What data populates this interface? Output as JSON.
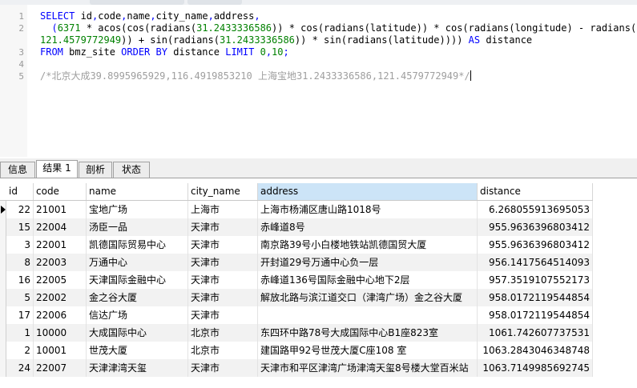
{
  "editor": {
    "line_numbers": [
      "1",
      "2",
      "",
      "3",
      "4",
      "5"
    ],
    "lines": [
      [
        {
          "c": "kw",
          "t": "SELECT "
        },
        {
          "c": "plain",
          "t": "id"
        },
        {
          "c": "kw",
          "t": ","
        },
        {
          "c": "plain",
          "t": "code"
        },
        {
          "c": "kw",
          "t": ","
        },
        {
          "c": "plain",
          "t": "name"
        },
        {
          "c": "kw",
          "t": ","
        },
        {
          "c": "plain",
          "t": "city_name"
        },
        {
          "c": "kw",
          "t": ","
        },
        {
          "c": "plain",
          "t": "address"
        },
        {
          "c": "kw",
          "t": ","
        }
      ],
      [
        {
          "c": "kw",
          "t": "  ("
        },
        {
          "c": "num",
          "t": "6371"
        },
        {
          "c": "plain",
          "t": " * acos(cos(radians("
        },
        {
          "c": "num",
          "t": "31.2433336586"
        },
        {
          "c": "plain",
          "t": ")) * cos(radians(latitude)) * cos(radians(longitude) - radians("
        }
      ],
      [
        {
          "c": "num",
          "t": "121.4579772949"
        },
        {
          "c": "plain",
          "t": ")) + sin(radians("
        },
        {
          "c": "num",
          "t": "31.2433336586"
        },
        {
          "c": "plain",
          "t": ")) * sin(radians(latitude)))) "
        },
        {
          "c": "kw",
          "t": "AS "
        },
        {
          "c": "plain",
          "t": "distance"
        }
      ],
      [
        {
          "c": "kw",
          "t": "FROM "
        },
        {
          "c": "plain",
          "t": "bmz_site "
        },
        {
          "c": "kw",
          "t": "ORDER BY "
        },
        {
          "c": "plain",
          "t": "distance "
        },
        {
          "c": "kw",
          "t": "LIMIT "
        },
        {
          "c": "num",
          "t": "0"
        },
        {
          "c": "kw",
          "t": ","
        },
        {
          "c": "num",
          "t": "10"
        },
        {
          "c": "kw",
          "t": ";"
        }
      ],
      [],
      [
        {
          "c": "cmt",
          "t": "/*北京大成39.8995965929,116.4919853210 上海宝地31.2433336586,121.4579772949*/"
        }
      ]
    ]
  },
  "tabs": [
    {
      "label": "信息",
      "active": false
    },
    {
      "label": "结果 1",
      "active": true
    },
    {
      "label": "剖析",
      "active": false
    },
    {
      "label": "状态",
      "active": false
    }
  ],
  "grid": {
    "columns": [
      "id",
      "code",
      "name",
      "city_name",
      "address",
      "distance"
    ],
    "selected_column": "address",
    "rows": [
      {
        "id": "22",
        "code": "21001",
        "name": "宝地广场",
        "city_name": "上海市",
        "address": "上海市杨浦区唐山路1018号",
        "distance": "6.268055913695053"
      },
      {
        "id": "15",
        "code": "22004",
        "name": "汤臣一品",
        "city_name": "天津市",
        "address": "赤峰道8号",
        "distance": "955.9636396803412"
      },
      {
        "id": "3",
        "code": "22001",
        "name": "凯德国际贸易中心",
        "city_name": "天津市",
        "address": "南京路39号小白楼地铁站凯德国贸大厦",
        "distance": "955.9636396803412"
      },
      {
        "id": "8",
        "code": "22003",
        "name": "万通中心",
        "city_name": "天津市",
        "address": "开封道29号万通中心负一层",
        "distance": "956.1417564514093"
      },
      {
        "id": "16",
        "code": "22005",
        "name": "天津国际金融中心",
        "city_name": "天津市",
        "address": "赤峰道136号国际金融中心地下2层",
        "distance": "957.3519107552173"
      },
      {
        "id": "5",
        "code": "22002",
        "name": "金之谷大厦",
        "city_name": "天津市",
        "address": "解放北路与滨江道交口（津湾广场）金之谷大厦",
        "distance": "958.0172119544854"
      },
      {
        "id": "17",
        "code": "22006",
        "name": "信达广场",
        "city_name": "天津市",
        "address": "",
        "distance": "958.0172119544854"
      },
      {
        "id": "1",
        "code": "10000",
        "name": "大成国际中心",
        "city_name": "北京市",
        "address": "东四环中路78号大成国际中心B1座823室",
        "distance": "1061.742607737531"
      },
      {
        "id": "2",
        "code": "10001",
        "name": "世茂大厦",
        "city_name": "北京市",
        "address": "建国路甲92号世茂大厦C座108 室",
        "distance": "1063.2843046348748"
      },
      {
        "id": "24",
        "code": "22007",
        "name": "天津津湾天玺",
        "city_name": "天津市",
        "address": "天津市和平区津湾广场津湾天玺8号楼大堂百米站",
        "distance": "1063.7149985692745"
      }
    ]
  }
}
